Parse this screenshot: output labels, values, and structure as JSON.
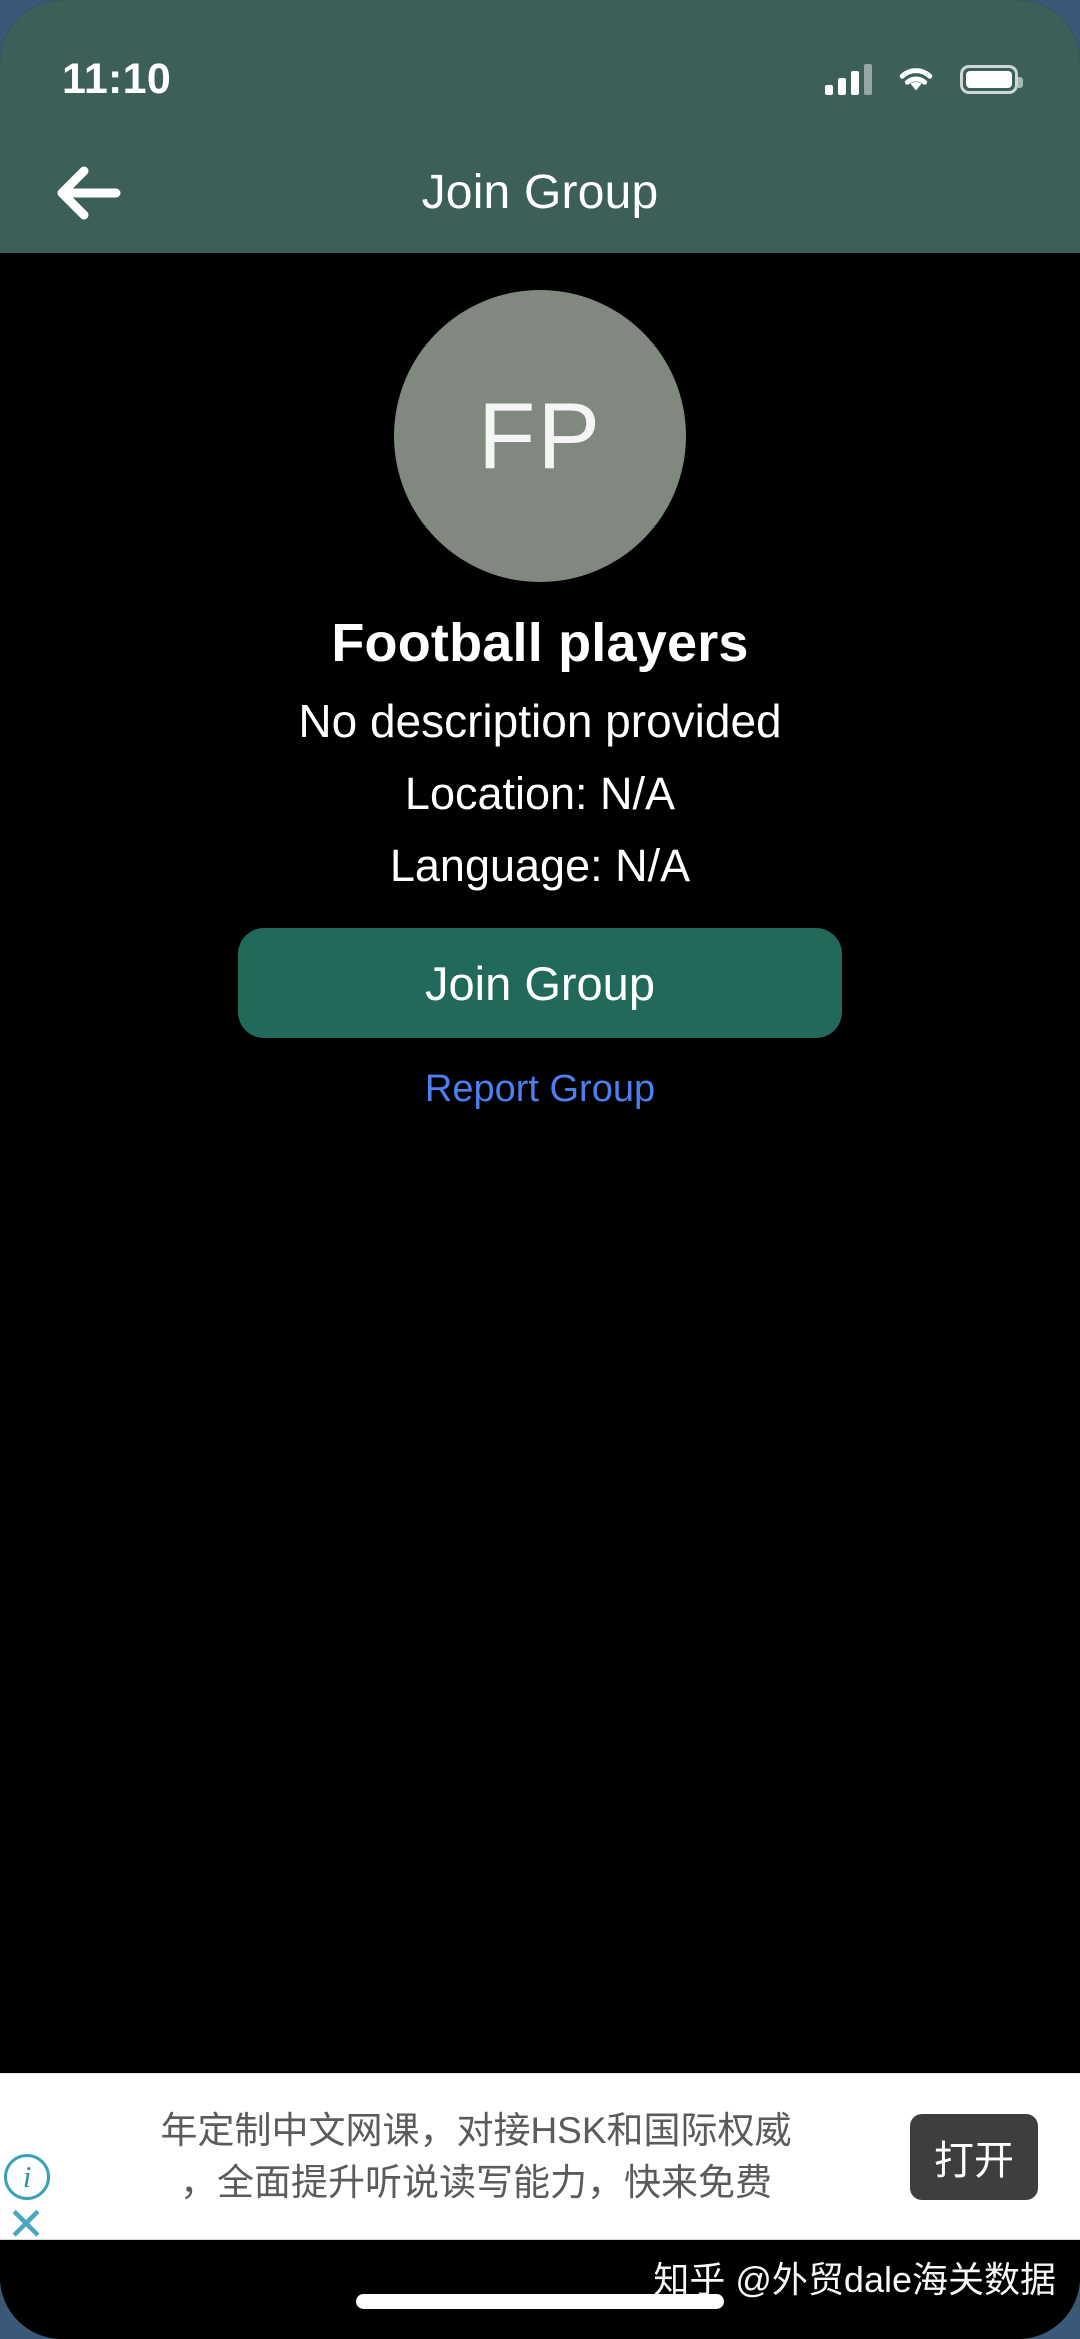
{
  "status_bar": {
    "time": "11:10",
    "signal_icon": "signal-bars-icon",
    "wifi_icon": "wifi-icon",
    "battery_icon": "battery-full-icon"
  },
  "header": {
    "back_icon": "arrow-left-icon",
    "title": "Join Group",
    "background_color": "#3c6058"
  },
  "group": {
    "avatar_initials": "FP",
    "avatar_color": "#808880",
    "name": "Football players",
    "description": "No description provided",
    "location": "Location: N/A",
    "language": "Language: N/A"
  },
  "actions": {
    "join_label": "Join Group",
    "join_color": "#21695b",
    "report_label": "Report Group",
    "report_color": "#4c7ff0"
  },
  "ad": {
    "info_icon": "info-circle-icon",
    "close_icon": "close-x-icon",
    "text_line_1": "年定制中文网课，对接HSK和国际权威",
    "text_line_2": "，全面提升听说读写能力，快来免费",
    "cta_label": "打开",
    "cta_color": "#3e3e3e"
  },
  "footer": {
    "watermark": "知乎 @外贸dale海关数据",
    "home_indicator": "home-indicator"
  }
}
